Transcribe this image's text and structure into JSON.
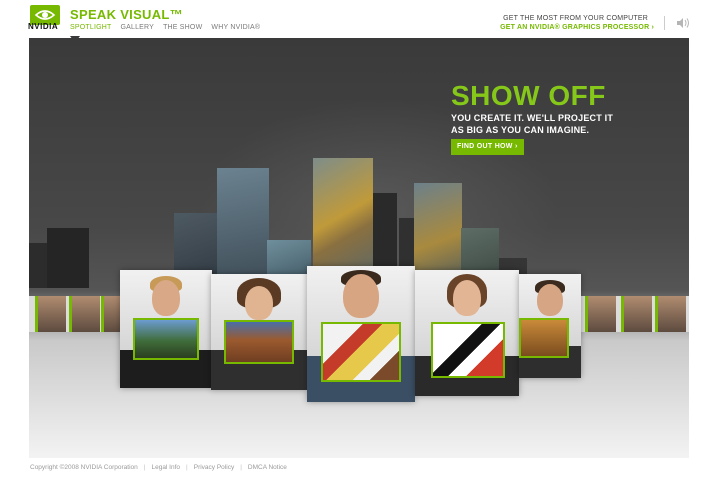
{
  "header": {
    "logo_text": "NVIDIA",
    "brand": "SPEAK VISUAL™",
    "nav": [
      "SPOTLIGHT",
      "GALLERY",
      "THE SHOW",
      "WHY NVIDIA®"
    ],
    "promo_line1": "GET THE MOST FROM YOUR COMPUTER",
    "promo_line2": "GET AN NVIDIA® GRAPHICS PROCESSOR ›",
    "speaker_icon": "speaker-icon"
  },
  "hero": {
    "headline": "SHOW OFF",
    "subline1": "YOU CREATE IT. WE'LL PROJECT IT",
    "subline2": "AS BIG AS YOU CAN IMAGINE.",
    "cta": "FIND OUT HOW ›"
  },
  "footer": {
    "copyright": "Copyright ©2008 NVIDIA Corporation",
    "links": [
      "Legal Info",
      "Privacy Policy",
      "DMCA Notice"
    ]
  },
  "colors": {
    "accent": "#76b900",
    "stage_dark": "#3a3a3a"
  }
}
